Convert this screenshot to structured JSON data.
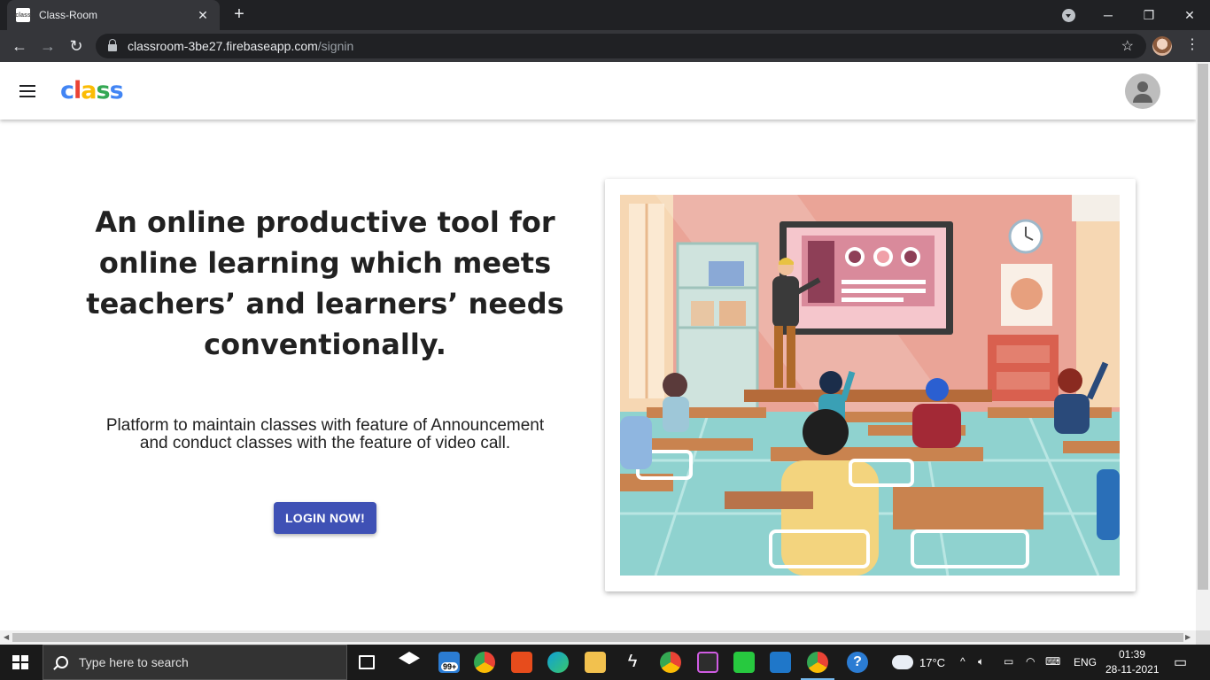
{
  "browser": {
    "tab_title": "Class-Room",
    "tab_favicon": "class",
    "tab_close": "✕",
    "new_tab": "+",
    "url_host": "classroom-3be27.firebaseapp.com",
    "url_path": "/signin",
    "window_controls": [
      "─",
      "❐",
      "✕"
    ]
  },
  "app": {
    "logo_letters": [
      "c",
      "l",
      "a",
      "s",
      "s"
    ],
    "hero_title": "An online productive tool for online learning which meets teachers’ and learners’ needs conventionally.",
    "hero_subtitle": "Platform to maintain classes with feature of Announcement and conduct classes with the feature of video call.",
    "login_button": "LOGIN NOW!"
  },
  "taskbar": {
    "search_placeholder": "Type here to search",
    "mail_badge": "99+",
    "weather_temp": "17°C",
    "language": "ENG",
    "time": "01:39",
    "date": "28-11-2021"
  },
  "colors": {
    "primary_button": "#3f51b5",
    "chrome_dark": "#202124",
    "taskbar": "#1a1a1a"
  }
}
